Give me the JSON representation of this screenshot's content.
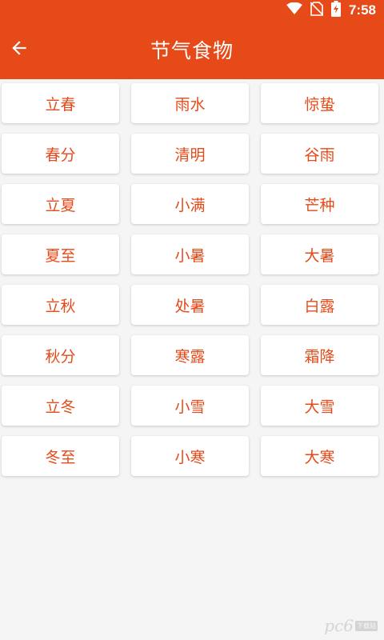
{
  "colors": {
    "primary": "#e64a19",
    "background": "#f5f5f5",
    "card": "#ffffff"
  },
  "status_bar": {
    "time": "7:58",
    "icons": [
      "wifi-icon",
      "no-sim-icon",
      "battery-charging-icon"
    ]
  },
  "app_bar": {
    "title": "节气食物",
    "back_icon": "arrow-left-icon"
  },
  "solar_terms": [
    "立春",
    "雨水",
    "惊蛰",
    "春分",
    "清明",
    "谷雨",
    "立夏",
    "小满",
    "芒种",
    "夏至",
    "小暑",
    "大暑",
    "立秋",
    "处暑",
    "白露",
    "秋分",
    "寒露",
    "霜降",
    "立冬",
    "小雪",
    "大雪",
    "冬至",
    "小寒",
    "大寒"
  ],
  "watermark": {
    "logo": "pc6",
    "badge": "下载站"
  }
}
